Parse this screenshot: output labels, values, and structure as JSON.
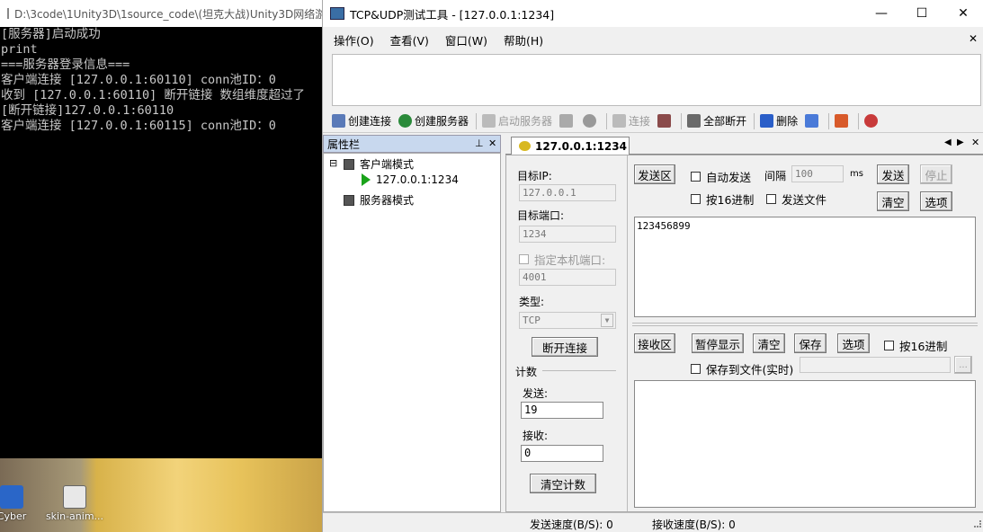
{
  "console": {
    "title": "D:\\3code\\1Unity3D\\1source_code\\(坦克大战)Unity3D网络游",
    "lines": [
      "[服务器]启动成功",
      "print",
      "===服务器登录信息===",
      "客户端连接 [127.0.0.1:60110] conn池ID：0",
      "收到 [127.0.0.1:60110] 断开链接 数组维度超过了",
      "[断开链接]127.0.0.1:60110",
      "客户端连接 [127.0.0.1:60115] conn池ID：0"
    ]
  },
  "desktop": {
    "icons": [
      {
        "label": "Cyber",
        "icon": "cyber-app-icon"
      },
      {
        "label": "skin-anim...",
        "icon": "skin-anim-file-icon"
      }
    ]
  },
  "window": {
    "title": "TCP&UDP测试工具 - [127.0.0.1:1234]",
    "minimize": "—",
    "maximize": "☐",
    "close": "✕"
  },
  "menu": {
    "items": [
      "操作(O)",
      "查看(V)",
      "窗口(W)",
      "帮助(H)"
    ],
    "close": "✕"
  },
  "toolbar": {
    "create_connection": "创建连接",
    "create_server": "创建服务器",
    "start_server": "启动服务器",
    "connect": "连接",
    "disconnect_all": "全部断开",
    "delete": "删除"
  },
  "properties": {
    "title": "属性栏",
    "pin": "⊥",
    "close": "✕",
    "tree": {
      "client_mode": "客户端模式",
      "client_connection": "127.0.0.1:1234",
      "server_mode": "服务器模式",
      "expander": "⊟"
    }
  },
  "tab": {
    "label": "127.0.0.1:1234",
    "nav_prev": "◀",
    "nav_next": "▶",
    "close": "✕"
  },
  "connection": {
    "target_ip_label": "目标IP:",
    "target_ip": "127.0.0.1",
    "target_port_label": "目标端口:",
    "target_port": "1234",
    "local_port_label": "指定本机端口:",
    "local_port": "4001",
    "type_label": "类型:",
    "type_value": "TCP",
    "disconnect_button": "断开连接",
    "count_label": "计数",
    "send_label": "发送:",
    "send_count": "19",
    "recv_label": "接收:",
    "recv_count": "0",
    "clear_count_button": "清空计数"
  },
  "send_area": {
    "label_button": "发送区",
    "auto_send": "自动发送",
    "interval_label": "间隔",
    "interval_value": "100",
    "interval_unit": "ms",
    "send_button": "发送",
    "stop_button": "停止",
    "hex_checkbox": "按16进制",
    "send_file_checkbox": "发送文件",
    "clear_button": "清空",
    "options_button": "选项",
    "content": "123456899"
  },
  "recv_area": {
    "label_button": "接收区",
    "pause_button": "暂停显示",
    "clear_button": "清空",
    "save_button": "保存",
    "options_button": "选项",
    "hex_checkbox": "按16进制",
    "save_to_file": "保存到文件(实时)",
    "browse_button": "...",
    "content": ""
  },
  "status": {
    "send_speed": "发送速度(B/S): 0",
    "recv_speed": "接收速度(B/S): 0"
  }
}
